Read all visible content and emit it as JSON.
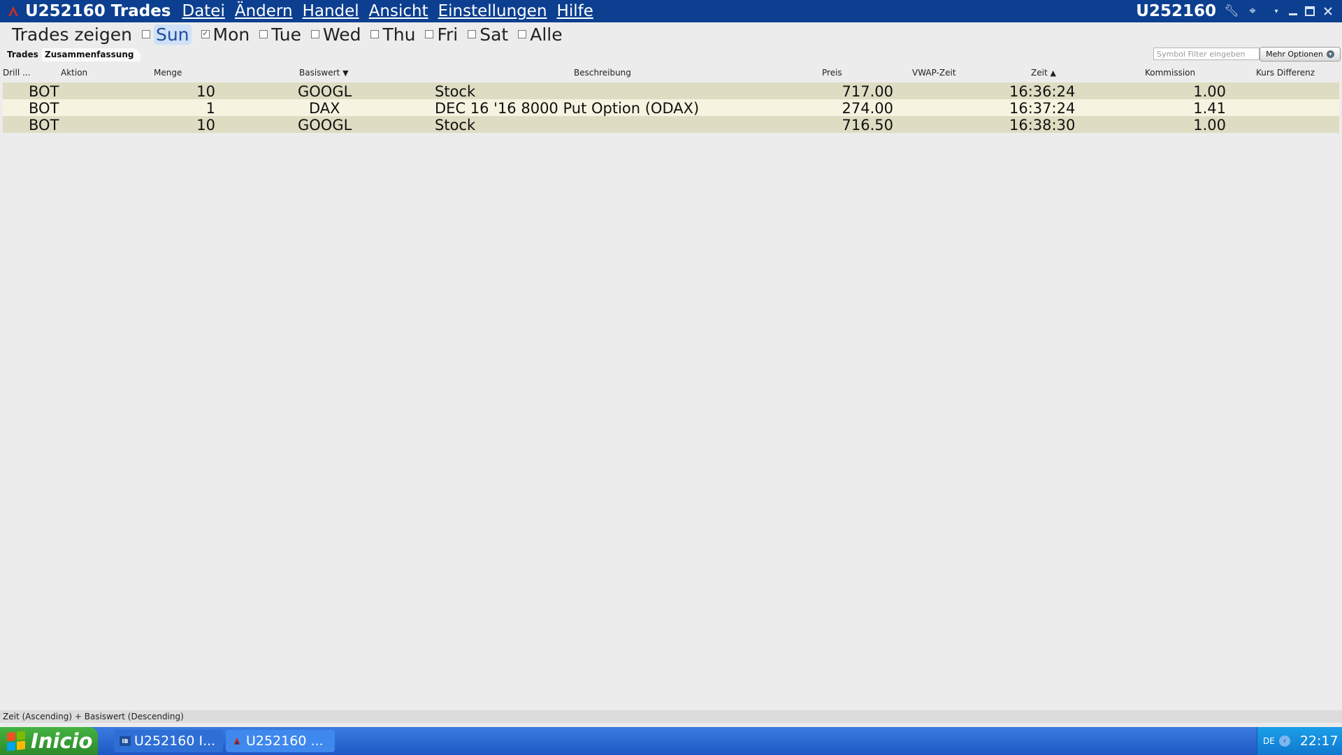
{
  "window": {
    "title": "U252160 Trades",
    "account": "U252160"
  },
  "menu": [
    "Datei",
    "Ändern",
    "Handel",
    "Ansicht",
    "Einstellungen",
    "Hilfe"
  ],
  "daybar": {
    "label": "Trades zeigen",
    "days": [
      {
        "label": "Sun",
        "checked": false
      },
      {
        "label": "Mon",
        "checked": true
      },
      {
        "label": "Tue",
        "checked": false
      },
      {
        "label": "Wed",
        "checked": false
      },
      {
        "label": "Thu",
        "checked": false
      },
      {
        "label": "Fri",
        "checked": false
      },
      {
        "label": "Sat",
        "checked": false
      },
      {
        "label": "Alle",
        "checked": false
      }
    ]
  },
  "tabs": {
    "trades": "Trades",
    "summary": "Zusammenfassung"
  },
  "filter": {
    "placeholder": "Symbol Filter eingeben"
  },
  "options_button": "Mehr Optionen",
  "columns": {
    "drill": "Drill ...",
    "aktion": "Aktion",
    "menge": "Menge",
    "basiswert": "Basiswert",
    "beschreibung": "Beschreibung",
    "preis": "Preis",
    "vwap": "VWAP-Zeit",
    "zeit": "Zeit",
    "kommission": "Kommission",
    "kurs_differenz": "Kurs Differenz"
  },
  "rows": [
    {
      "aktion": "BOT",
      "menge": "10",
      "basiswert": "GOOGL",
      "beschreibung": "Stock",
      "preis": "717.00",
      "zeit": "16:36:24",
      "kommission": "1.00"
    },
    {
      "aktion": "BOT",
      "menge": "1",
      "basiswert": "DAX",
      "beschreibung": "DEC 16 '16 8000 Put Option (ODAX)",
      "preis": "274.00",
      "zeit": "16:37:24",
      "kommission": "1.41"
    },
    {
      "aktion": "BOT",
      "menge": "10",
      "basiswert": "GOOGL",
      "beschreibung": "Stock",
      "preis": "716.50",
      "zeit": "16:38:30",
      "kommission": "1.00"
    }
  ],
  "status": "Zeit (Ascending)  +  Basiswert (Descending)",
  "taskbar": {
    "start": "Inicio",
    "tasks": [
      "U252160 I...",
      "U252160 ..."
    ],
    "lang": "DE",
    "clock": "22:17"
  }
}
